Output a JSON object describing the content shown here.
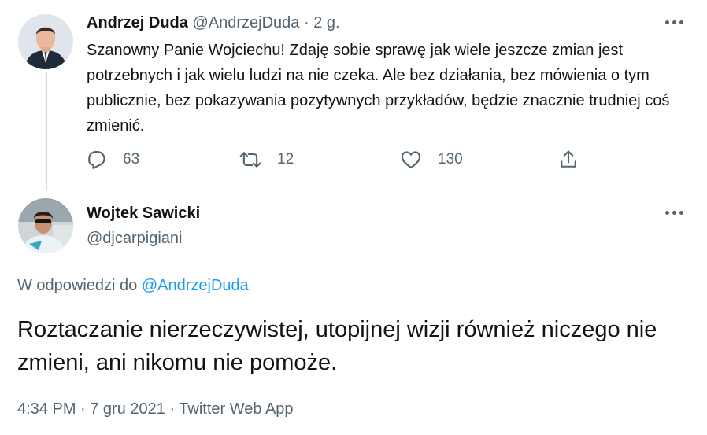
{
  "parent_tweet": {
    "author_name": "Andrzej Duda",
    "author_handle": "@AndrzejDuda",
    "separator": "·",
    "time_ago": "2 g.",
    "text": "Szanowny Panie Wojciechu! Zdaję sobie sprawę jak wiele jeszcze zmian jest potrzebnych i jak wielu ludzi na nie czeka. Ale bez działania, bez mówienia o tym publicznie, bez pokazywania pozytywnych przykładów, będzie znacznie trudniej coś zmienić.",
    "replies": "63",
    "retweets": "12",
    "likes": "130"
  },
  "main_tweet": {
    "author_name": "Wojtek Sawicki",
    "author_handle": "@djcarpigiani",
    "reply_prefix": "W odpowiedzi do",
    "reply_handle": "@AndrzejDuda",
    "text": "Roztaczanie nierzeczywistej, utopijnej wizji również niczego nie zmieni, ani nikomu nie pomoże.",
    "meta": "4:34 PM · 7 gru 2021 · Twitter Web App"
  },
  "icons": [
    "avatar-photo",
    "more-icon",
    "reply-icon",
    "retweet-icon",
    "like-icon",
    "share-icon"
  ],
  "colors": {
    "text": "#0f1419",
    "muted": "#536471",
    "link": "#1d9bf0",
    "thread_line": "#cfd9de"
  }
}
